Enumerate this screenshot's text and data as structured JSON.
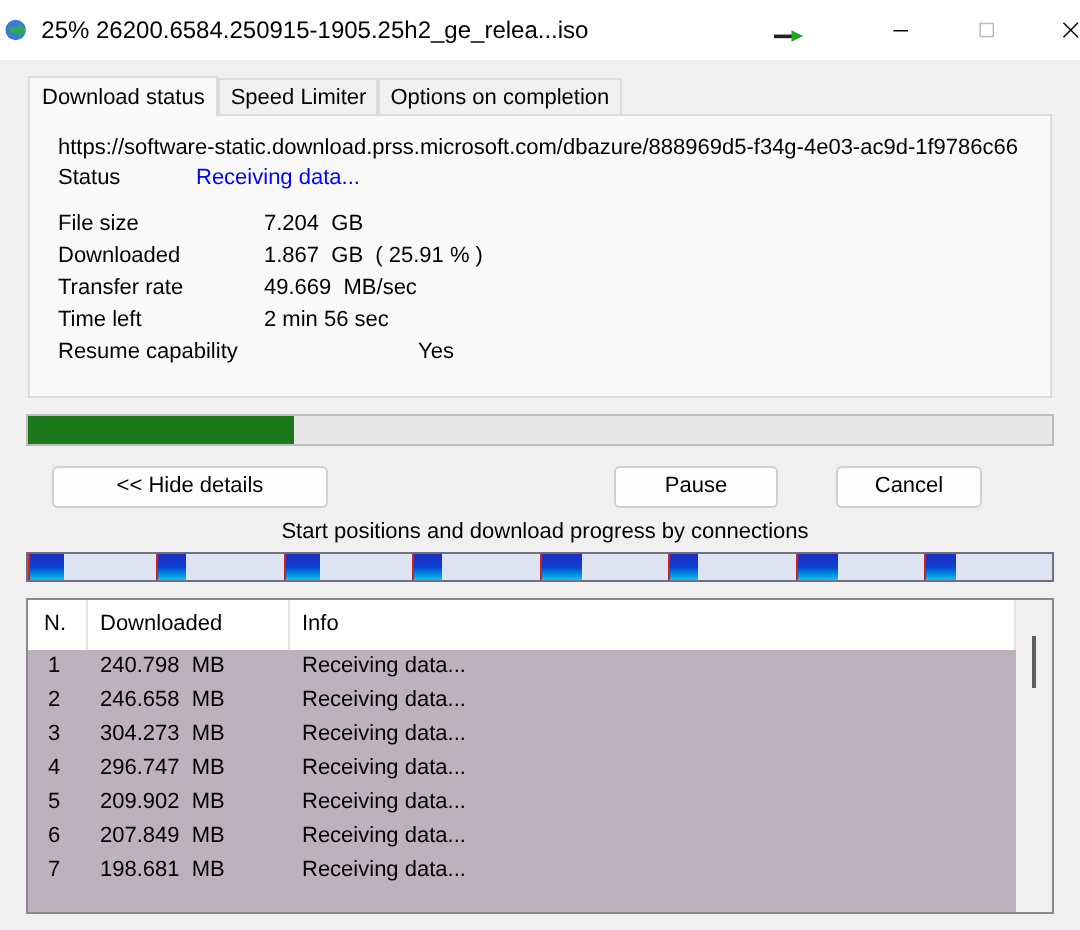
{
  "window": {
    "title": "25% 26200.6584.250915-1905.25h2_ge_relea...iso"
  },
  "tabs": [
    {
      "label": "Download status",
      "selected": true
    },
    {
      "label": "Speed Limiter",
      "selected": false
    },
    {
      "label": "Options on completion",
      "selected": false
    }
  ],
  "url": "https://software-static.download.prss.microsoft.com/dbazure/888969d5-f34g-4e03-ac9d-1f9786c66",
  "status": {
    "label": "Status",
    "value": "Receiving data..."
  },
  "details": [
    {
      "label": "File size",
      "value": "7.204  GB"
    },
    {
      "label": "Downloaded",
      "value": "1.867  GB  ( 25.91 % )"
    },
    {
      "label": "Transfer rate",
      "value": "49.669  MB/sec"
    },
    {
      "label": "Time left",
      "value": "2 min 56 sec"
    }
  ],
  "resume": {
    "label": "Resume capability",
    "value": "Yes"
  },
  "progress": {
    "level": 0.2591
  },
  "buttons": {
    "details": "<< Hide details",
    "pause": "Pause",
    "cancel": "Cancel"
  },
  "connections_caption": "Start positions and download progress by connections",
  "connections": [
    {
      "level": 0.27
    },
    {
      "level": 0.22
    },
    {
      "level": 0.27
    },
    {
      "level": 0.23
    },
    {
      "level": 0.31
    },
    {
      "level": 0.22
    },
    {
      "level": 0.31
    },
    {
      "level": 0.24
    }
  ],
  "table": {
    "columns": [
      "N.",
      "Downloaded",
      "Info"
    ],
    "rows": [
      [
        "1",
        "240.798  MB",
        "Receiving data..."
      ],
      [
        "2",
        "246.658  MB",
        "Receiving data..."
      ],
      [
        "3",
        "304.273  MB",
        "Receiving data..."
      ],
      [
        "4",
        "296.747  MB",
        "Receiving data..."
      ],
      [
        "5",
        "209.902  MB",
        "Receiving data..."
      ],
      [
        "6",
        "207.849  MB",
        "Receiving data..."
      ],
      [
        "7",
        "198.681  MB",
        "Receiving data..."
      ]
    ]
  }
}
